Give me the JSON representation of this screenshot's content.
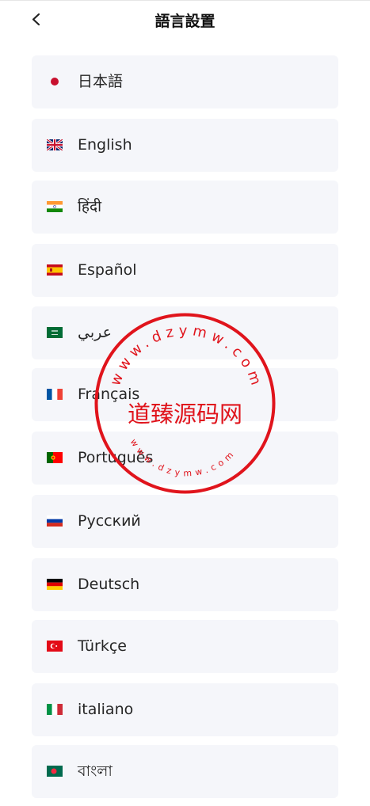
{
  "header": {
    "title": "語言設置",
    "back_icon": "chevron-left-icon"
  },
  "languages": [
    {
      "label": "日本語",
      "flag": "japan-flag-icon"
    },
    {
      "label": "English",
      "flag": "uk-flag-icon"
    },
    {
      "label": "हिंदी",
      "flag": "india-flag-icon"
    },
    {
      "label": "Español",
      "flag": "spain-flag-icon"
    },
    {
      "label": "عربي",
      "flag": "saudi-arabia-flag-icon"
    },
    {
      "label": "Français",
      "flag": "france-flag-icon"
    },
    {
      "label": "Português",
      "flag": "portugal-flag-icon"
    },
    {
      "label": "Русский",
      "flag": "russia-flag-icon"
    },
    {
      "label": "Deutsch",
      "flag": "germany-flag-icon"
    },
    {
      "label": "Türkçe",
      "flag": "turkey-flag-icon"
    },
    {
      "label": "italiano",
      "flag": "italy-flag-icon"
    },
    {
      "label": "বাংলা",
      "flag": "bangladesh-flag-icon"
    }
  ],
  "watermark": {
    "center_text": "道臻源码网",
    "ring_text": "www.dzymw.com",
    "color": "#e0141c"
  }
}
